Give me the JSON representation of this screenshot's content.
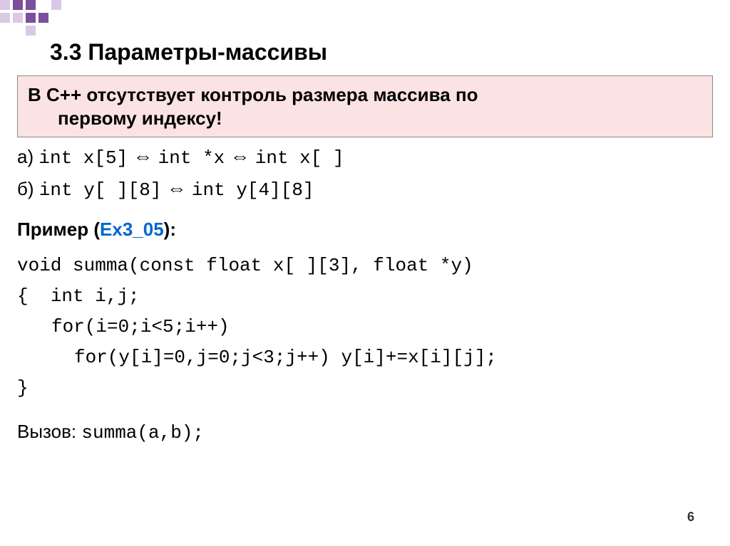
{
  "decoration": {
    "accent": "#7b4f9d",
    "light": "#d9c9e6"
  },
  "title": "3.3 Параметры-массивы",
  "banner": {
    "line1": "В С++ отсутствует контроль размера массива по",
    "line2": "первому индексу!"
  },
  "examples": {
    "a_label": "а)",
    "a_part1": "int x[5]",
    "a_part2": "int *x",
    "a_part3": "int x[ ]",
    "b_label": "б)",
    "b_part1": "int y[ ][8]",
    "b_part2": "int y[4][8]",
    "arrow_glyph": "⇔"
  },
  "example_heading": {
    "prefix": "Пример (",
    "name": "Ex3_05",
    "suffix": "):"
  },
  "code": {
    "l1": "void summa(const float x[ ][3], float *y)",
    "l2_open": "{",
    "l2_body": "int i,j;",
    "l3": "for(i=0;i<5;i++)",
    "l4": "for(y[i]=0,j=0;j<3;j++) y[i]+=x[i][j];",
    "l5": "}"
  },
  "call": {
    "label": "Вызов:",
    "expr": "summa(a,b);"
  },
  "page_number": "6"
}
